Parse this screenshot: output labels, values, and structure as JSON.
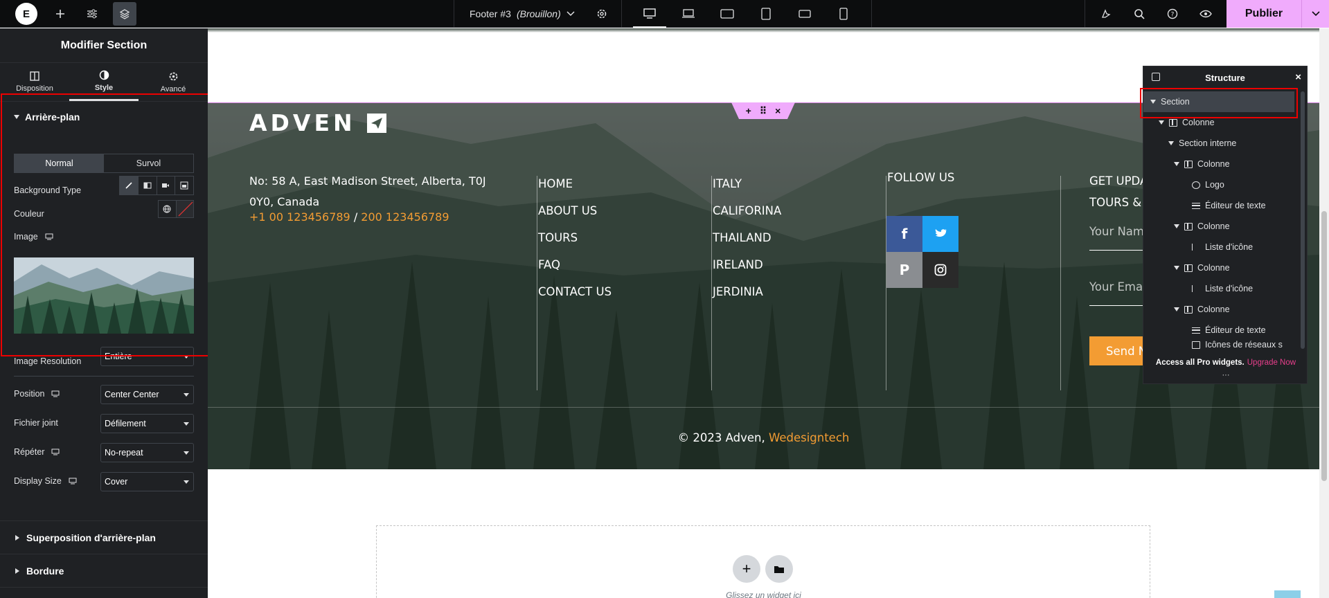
{
  "topbar": {
    "logo_letter": "E",
    "doc_name": "Footer #3",
    "doc_status": "(Brouillon)",
    "publish_label": "Publier"
  },
  "panel": {
    "title": "Modifier Section",
    "tabs": [
      {
        "label": "Disposition"
      },
      {
        "label": "Style"
      },
      {
        "label": "Avancé"
      }
    ],
    "background_section": {
      "title": "Arrière-plan",
      "states": [
        "Normal",
        "Survol"
      ],
      "active_state": "Normal",
      "background_type_label": "Background Type",
      "color_label": "Couleur",
      "image_label": "Image",
      "image_resolution_label": "Image Resolution",
      "image_resolution_value": "Entière",
      "position_label": "Position",
      "position_value": "Center Center",
      "attachment_label": "Fichier joint",
      "attachment_value": "Défilement",
      "repeat_label": "Répéter",
      "repeat_value": "No-repeat",
      "display_size_label": "Display Size",
      "display_size_value": "Cover"
    },
    "collapsed_sections": [
      "Superposition d'arrière-plan",
      "Bordure"
    ]
  },
  "footer": {
    "brand": "ADVEN",
    "address": "No: 58 A, East Madison Street, Alberta, T0J 0Y0, Canada",
    "phone1": "+1 00 123456789",
    "phone_sep": " / ",
    "phone2": "200 123456789",
    "links_col1": [
      "HOME",
      "ABOUT US",
      "TOURS",
      "FAQ",
      "CONTACT US"
    ],
    "links_col2": [
      "ITALY",
      "CALIFORINA",
      "THAILAND",
      "IRELAND",
      "JERDINIA"
    ],
    "follow_title": "FOLLOW US",
    "get_updates_line1": "GET UPDA",
    "get_updates_line2": "TOURS &",
    "name_placeholder": "Your Nam",
    "email_placeholder": "Your Ema",
    "send_label": "Send N",
    "copyright_text": "© 2023 Adven, ",
    "copyright_link": "Wedesigntech"
  },
  "canvas": {
    "drop_hint": "Glissez un widget ici"
  },
  "structure": {
    "title": "Structure",
    "nodes": [
      {
        "label": "Section",
        "icon": "caret"
      },
      {
        "label": "Colonne",
        "icon": "column"
      },
      {
        "label": "Section interne",
        "icon": "caret"
      },
      {
        "label": "Colonne",
        "icon": "column"
      },
      {
        "label": "Logo",
        "icon": "logo"
      },
      {
        "label": "Éditeur de texte",
        "icon": "text"
      },
      {
        "label": "Colonne",
        "icon": "column"
      },
      {
        "label": "Liste d'icône",
        "icon": "list"
      },
      {
        "label": "Colonne",
        "icon": "column"
      },
      {
        "label": "Liste d'icône",
        "icon": "list"
      },
      {
        "label": "Colonne",
        "icon": "column"
      },
      {
        "label": "Éditeur de texte",
        "icon": "text"
      },
      {
        "label": "Icônes de réseaux s",
        "icon": "social"
      }
    ],
    "footer_text": "Access all Pro widgets.",
    "footer_link": "Upgrade Now",
    "dots": "···"
  },
  "colors": {
    "accent_pink": "#f0abfc",
    "orange": "#f39c33",
    "panel_bg": "#1f2124",
    "facebook": "#3b5998",
    "twitter": "#1da1f2",
    "pinterest": "#8a8d91",
    "instagram": "#2a2a2a"
  },
  "icons": [
    "elementor-logo",
    "plus-icon",
    "sliders-icon",
    "layers-icon",
    "chevron-down-icon",
    "gear-icon",
    "desktop-icon",
    "laptop-icon",
    "tablet-landscape-icon",
    "tablet-icon",
    "mobile-landscape-icon",
    "mobile-icon",
    "ai-icon",
    "search-icon",
    "help-icon",
    "eye-icon"
  ]
}
